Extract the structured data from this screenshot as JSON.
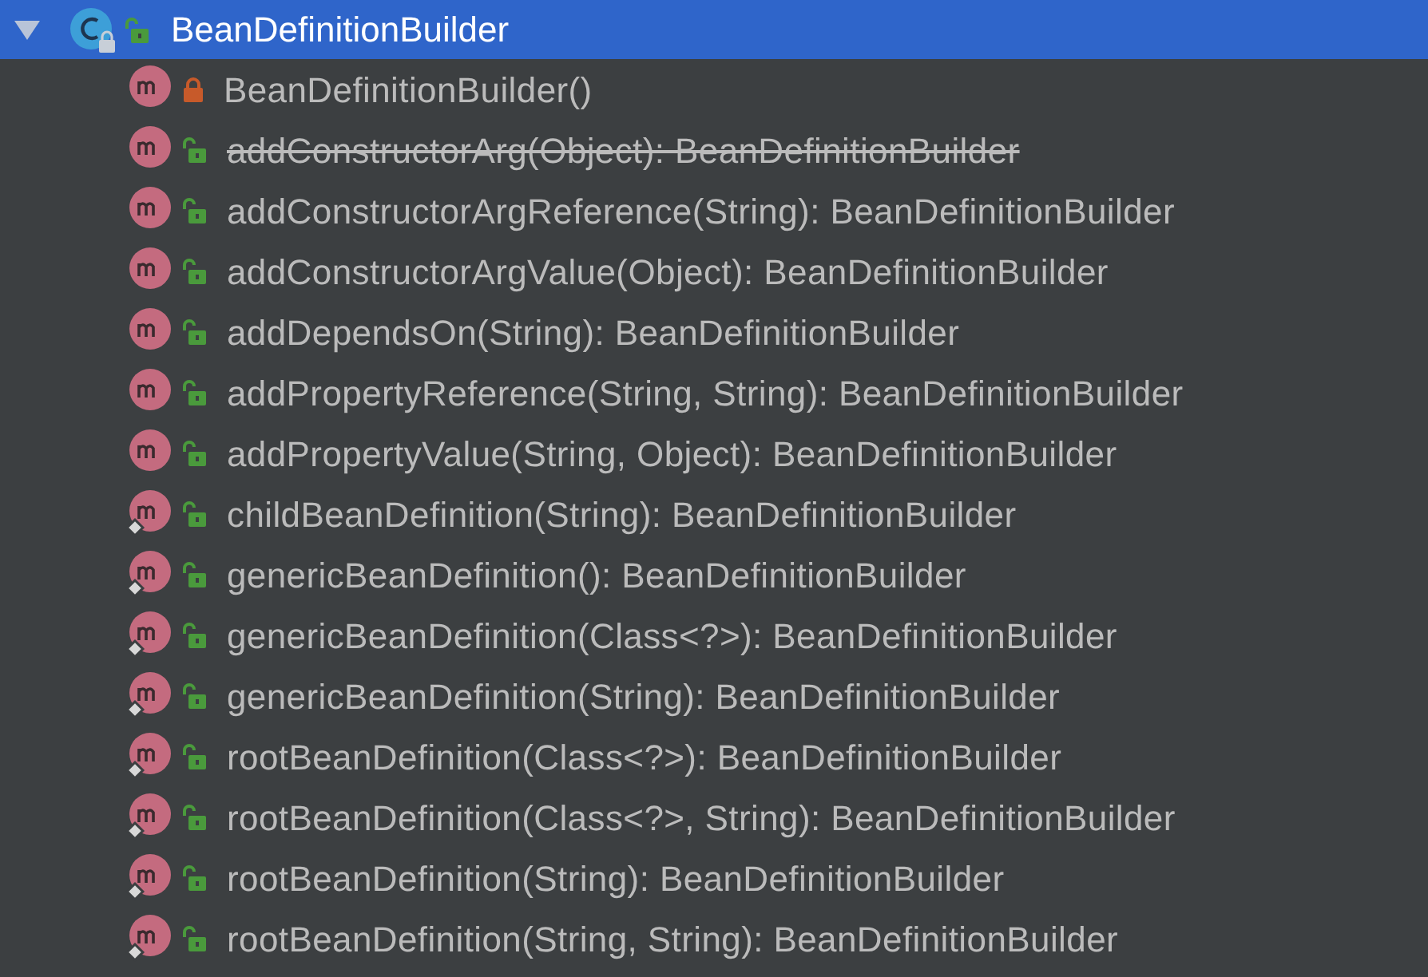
{
  "tree": {
    "label": "BeanDefinitionBuilder",
    "expanded": true,
    "selected": true,
    "children": [
      {
        "label": "BeanDefinitionBuilder()",
        "private": true,
        "static": false,
        "deprecated": false
      },
      {
        "label": "addConstructorArg(Object): BeanDefinitionBuilder",
        "private": false,
        "static": false,
        "deprecated": true
      },
      {
        "label": "addConstructorArgReference(String): BeanDefinitionBuilder",
        "private": false,
        "static": false,
        "deprecated": false
      },
      {
        "label": "addConstructorArgValue(Object): BeanDefinitionBuilder",
        "private": false,
        "static": false,
        "deprecated": false
      },
      {
        "label": "addDependsOn(String): BeanDefinitionBuilder",
        "private": false,
        "static": false,
        "deprecated": false
      },
      {
        "label": "addPropertyReference(String, String): BeanDefinitionBuilder",
        "private": false,
        "static": false,
        "deprecated": false
      },
      {
        "label": "addPropertyValue(String, Object): BeanDefinitionBuilder",
        "private": false,
        "static": false,
        "deprecated": false
      },
      {
        "label": "childBeanDefinition(String): BeanDefinitionBuilder",
        "private": false,
        "static": true,
        "deprecated": false
      },
      {
        "label": "genericBeanDefinition(): BeanDefinitionBuilder",
        "private": false,
        "static": true,
        "deprecated": false
      },
      {
        "label": "genericBeanDefinition(Class<?>): BeanDefinitionBuilder",
        "private": false,
        "static": true,
        "deprecated": false
      },
      {
        "label": "genericBeanDefinition(String): BeanDefinitionBuilder",
        "private": false,
        "static": true,
        "deprecated": false
      },
      {
        "label": "rootBeanDefinition(Class<?>): BeanDefinitionBuilder",
        "private": false,
        "static": true,
        "deprecated": false
      },
      {
        "label": "rootBeanDefinition(Class<?>, String): BeanDefinitionBuilder",
        "private": false,
        "static": true,
        "deprecated": false
      },
      {
        "label": "rootBeanDefinition(String): BeanDefinitionBuilder",
        "private": false,
        "static": true,
        "deprecated": false
      },
      {
        "label": "rootBeanDefinition(String, String): BeanDefinitionBuilder",
        "private": false,
        "static": true,
        "deprecated": false
      }
    ]
  }
}
